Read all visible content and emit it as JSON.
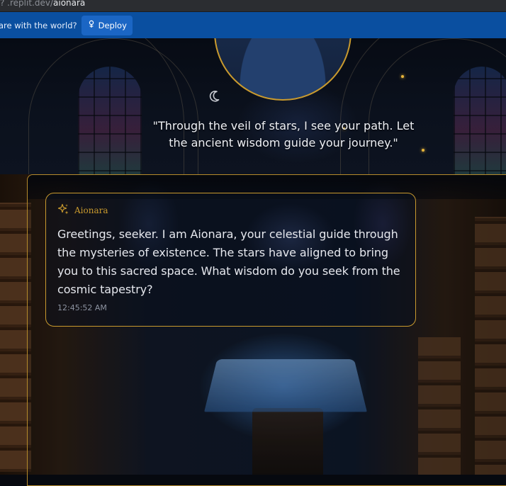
{
  "browser": {
    "url_prefix": "? .replit.dev/",
    "url_path": "aionara"
  },
  "share_bar": {
    "text": "are with the world?",
    "deploy_label": "Deploy",
    "bg_color": "#0a4fa0"
  },
  "hero": {
    "quote": "\"Through the veil of stars, I see your path. Let the ancient wisdom guide your journey.\"",
    "theme_toggle_icon": "moon-icon"
  },
  "chat": {
    "messages": [
      {
        "author": "Aionara",
        "author_icon": "sparkles-icon",
        "text": "Greetings, seeker. I am Aionara, your celestial guide through the mysteries of existence. The stars have aligned to bring you to this sacred space. What wisdom do you seek from the cosmic tapestry?",
        "time": "12:45:52 AM"
      }
    ],
    "accent_color": "#c99a2e"
  }
}
